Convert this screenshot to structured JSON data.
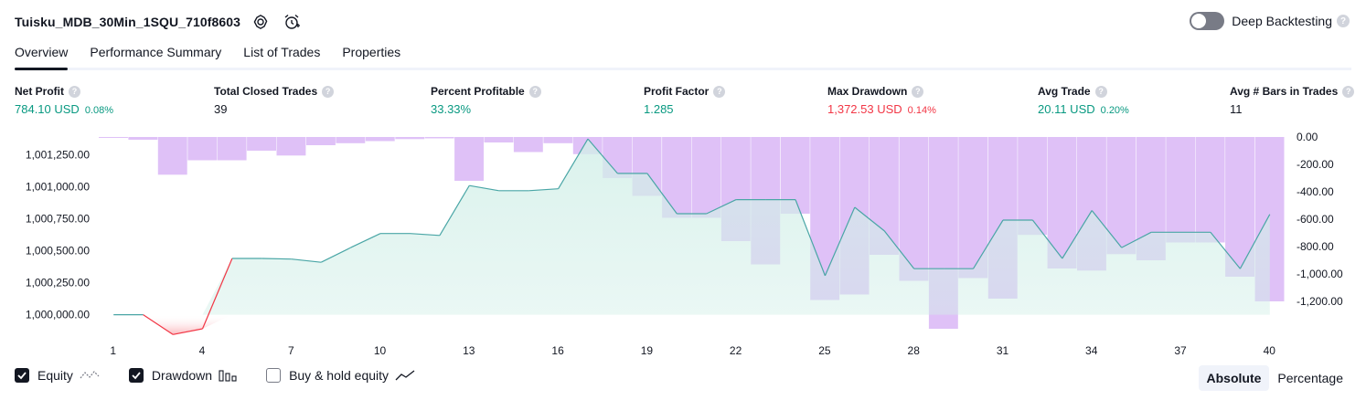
{
  "header": {
    "strategy_name": "Tuisku_MDB_30Min_1SQU_710f8603",
    "deep_backtesting_label": "Deep Backtesting",
    "help_glyph": "?"
  },
  "tabs": [
    {
      "label": "Overview",
      "active": true
    },
    {
      "label": "Performance Summary",
      "active": false
    },
    {
      "label": "List of Trades",
      "active": false
    },
    {
      "label": "Properties",
      "active": false
    }
  ],
  "metrics": [
    {
      "label": "Net Profit",
      "value": "784.10 USD",
      "pct": "0.08%",
      "tone": "pos"
    },
    {
      "label": "Total Closed Trades",
      "value": "39",
      "pct": "",
      "tone": "neutral"
    },
    {
      "label": "Percent Profitable",
      "value": "33.33%",
      "pct": "",
      "tone": "pos"
    },
    {
      "label": "Profit Factor",
      "value": "1.285",
      "pct": "",
      "tone": "pos"
    },
    {
      "label": "Max Drawdown",
      "value": "1,372.53 USD",
      "pct": "0.14%",
      "tone": "neg"
    },
    {
      "label": "Avg Trade",
      "value": "20.11 USD",
      "pct": "0.20%",
      "tone": "pos"
    },
    {
      "label": "Avg # Bars in Trades",
      "value": "11",
      "pct": "",
      "tone": "neutral"
    }
  ],
  "legend": {
    "equity": {
      "label": "Equity",
      "checked": true
    },
    "drawdown": {
      "label": "Drawdown",
      "checked": true
    },
    "buy_hold": {
      "label": "Buy & hold equity",
      "checked": false
    }
  },
  "mode": {
    "absolute": "Absolute",
    "percentage": "Percentage",
    "active": "Absolute"
  },
  "colors": {
    "positive": "#089981",
    "negative": "#f23645",
    "drawdown_fill": "#dbbaf6",
    "equity_line": "#4aa6a6",
    "equity_fill": "#d2efe8"
  },
  "chart_data": {
    "type": "area",
    "x_ticks": [
      "1",
      "4",
      "7",
      "10",
      "13",
      "16",
      "19",
      "22",
      "25",
      "28",
      "31",
      "34",
      "37",
      "40"
    ],
    "left_ticks": [
      "1,001,250.00",
      "1,001,000.00",
      "1,000,750.00",
      "1,000,500.00",
      "1,000,250.00",
      "1,000,000.00"
    ],
    "right_ticks": [
      "0.00",
      "-200.00",
      "-400.00",
      "-600.00",
      "-800.00",
      "-1,000.00",
      "-1,200.00"
    ],
    "equity_ylim": [
      999890,
      1001390
    ],
    "drawdown_ylim": [
      -1400,
      0
    ],
    "x": [
      1,
      2,
      3,
      4,
      5,
      6,
      7,
      8,
      9,
      10,
      11,
      12,
      13,
      14,
      15,
      16,
      17,
      18,
      19,
      20,
      21,
      22,
      23,
      24,
      25,
      26,
      27,
      28,
      29,
      30,
      31,
      32,
      33,
      34,
      35,
      36,
      37,
      38,
      39,
      40
    ],
    "series": [
      {
        "name": "Equity",
        "values": [
          1000000,
          1000000,
          999845,
          999890,
          1000440,
          1000440,
          1000435,
          1000410,
          1000525,
          1000635,
          1000635,
          1000620,
          1001010,
          1000970,
          1000970,
          1000985,
          1001375,
          1001105,
          1001105,
          1000790,
          1000790,
          1000900,
          1000900,
          1000900,
          1000305,
          1000840,
          1000655,
          1000360,
          1000360,
          1000360,
          1000740,
          1000740,
          1000440,
          1000815,
          1000525,
          1000645,
          1000645,
          1000645,
          1000360,
          1000785
        ]
      },
      {
        "name": "Drawdown",
        "values": [
          0,
          -20,
          -275,
          -170,
          -170,
          -100,
          -135,
          -60,
          -45,
          -30,
          -15,
          -10,
          -320,
          -40,
          -110,
          -45,
          -125,
          -300,
          -430,
          -590,
          -590,
          -760,
          -930,
          -560,
          -1190,
          -1150,
          -860,
          -1050,
          -1400,
          -1030,
          -1180,
          -715,
          -960,
          -975,
          -855,
          -900,
          -770,
          -770,
          -1020,
          -1200
        ]
      }
    ]
  }
}
